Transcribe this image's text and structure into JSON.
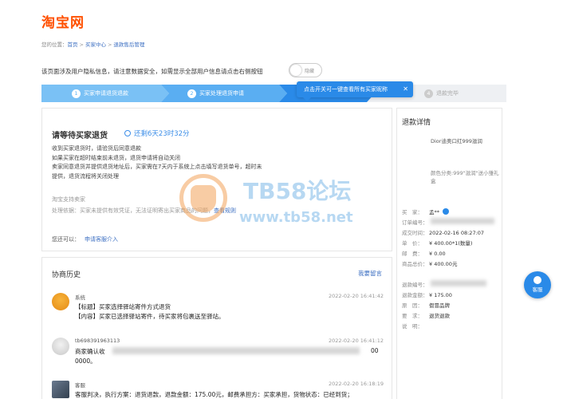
{
  "logo": "淘宝网",
  "breadcrumb": {
    "prefix": "您的位置：",
    "items": [
      "首页",
      "买家中心",
      "退款售后管理"
    ]
  },
  "privacy": {
    "text": "该页面涉及用户隐私信息，请注意数据安全，如需显示全部用户信息请点击右侧按钮",
    "toggle_label": "隐藏"
  },
  "steps": [
    {
      "num": "1",
      "label": "买家申请退货退款"
    },
    {
      "num": "2",
      "label": "买家处理退货申请"
    },
    {
      "num": "4",
      "label": "退款完毕"
    }
  ],
  "tooltip": {
    "text": "点击开关可一键查看所有买家昵称",
    "close": "✕"
  },
  "main": {
    "title": "请等待买家退货",
    "countdown": "还剩6天23时32分",
    "paragraphs": [
      "收到买家退货时，请验货后同意退款",
      "如果买家在超时结束前未退货，退货申请将自动关闭",
      "卖家同意退货并提供退货地址后，买家需在7天内于系统上点击填写退货单号，超时未",
      "提供，退货流程将关闭处理"
    ],
    "support_label": "淘宝支持卖家",
    "basis_text": "处理依据：买家未提供有效凭证，无法证明寄出买家商品的问题，",
    "basis_link": "查看规则",
    "also_label": "您还可以：",
    "also_link": "申请客服介入"
  },
  "history": {
    "title": "协商历史",
    "leave_msg": "我要留言",
    "entries": [
      {
        "name": "系统",
        "time": "2022-02-20 16:41:42",
        "lines": [
          "【标题】买家选择驿站寄件方式退货",
          "【内容】买家已选择驿站寄件，待买家将包裹送至驿站。"
        ]
      },
      {
        "name": "tb698391963113",
        "time": "2022-02-20 16:41:12",
        "lines": [
          "商家确认收",
          "0000。",
          "00"
        ]
      },
      {
        "name": "客服",
        "time": "2022-02-20 16:18:19",
        "lines": [
          "客服判决，执行方案：退货退款，退款金额：175.00元，邮费承担方：买家承担，货物状态：已经到货；"
        ]
      }
    ]
  },
  "side": {
    "title": "退款详情",
    "product_name": "Dior迪奥口红999滋润",
    "product_attr": "颜色分类:999\"滋润\"送小雏礼盒",
    "fields": [
      {
        "k": "买　家：",
        "v": "孟**"
      },
      {
        "k": "订单编号：",
        "v": ""
      },
      {
        "k": "成交时间：",
        "v": "2022-02-16 08:27:07"
      },
      {
        "k": "单　价：",
        "v": "¥ 400.00*1(数量)"
      },
      {
        "k": "邮　费：",
        "v": "¥ 0.00"
      },
      {
        "k": "商品总价：",
        "v": "¥ 400.00元"
      },
      {
        "k": "退款编号：",
        "v": ""
      },
      {
        "k": "退款金额：",
        "v": "¥ 175.00"
      },
      {
        "k": "原　因：",
        "v": "假冒品牌"
      },
      {
        "k": "要　求：",
        "v": "退货退款"
      },
      {
        "k": "说　明：",
        "v": ""
      }
    ]
  },
  "help_label": "客服",
  "watermark": {
    "text": "TB58论坛",
    "url": "www.tb58.net"
  }
}
